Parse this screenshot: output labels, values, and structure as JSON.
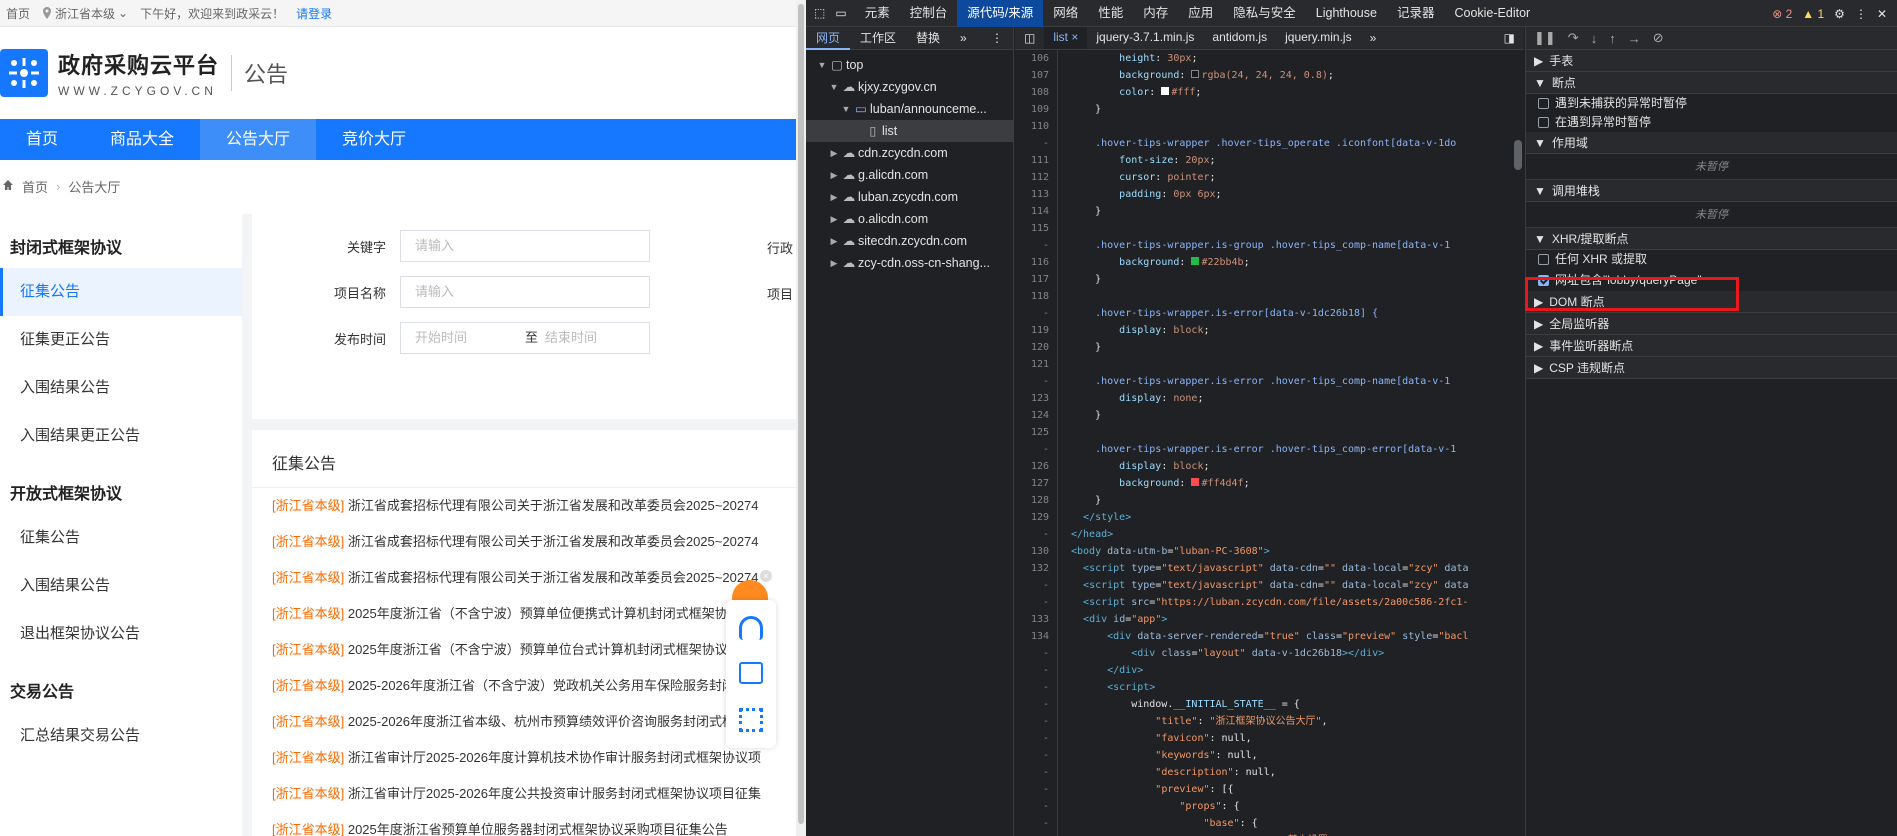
{
  "web": {
    "topbar": {
      "home": "首页",
      "location": "浙江省本级",
      "greeting": "下午好，欢迎来到政采云！",
      "login": "请登录"
    },
    "brand": {
      "name": "政府采购云平台",
      "url": "WWW.ZCYGOV.CN",
      "sub": "公告"
    },
    "nav": [
      "首页",
      "商品大全",
      "公告大厅",
      "竞价大厅"
    ],
    "breadcrumb": [
      "首页",
      "公告大厅"
    ],
    "sidebar": {
      "groups": [
        {
          "title": "封闭式框架协议",
          "items": [
            "征集公告",
            "征集更正公告",
            "入围结果公告",
            "入围结果更正公告"
          ]
        },
        {
          "title": "开放式框架协议",
          "items": [
            "征集公告",
            "入围结果公告",
            "退出框架协议公告"
          ]
        },
        {
          "title": "交易公告",
          "items": [
            "汇总结果交易公告"
          ]
        }
      ]
    },
    "filter": {
      "keyword_label": "关键字",
      "keyword_placeholder": "请输入",
      "project_label": "项目名称",
      "project_placeholder": "请输入",
      "date_label": "发布时间",
      "date_start": "开始时间",
      "date_sep": "至",
      "date_end": "结束时间",
      "right1": "行政",
      "right2": "项目"
    },
    "list": {
      "title": "征集公告",
      "items": [
        {
          "tag": "[浙江省本级]",
          "text": " 浙江省成套招标代理有限公司关于浙江省发展和改革委员会2025~20274"
        },
        {
          "tag": "[浙江省本级]",
          "text": " 浙江省成套招标代理有限公司关于浙江省发展和改革委员会2025~20274"
        },
        {
          "tag": "[浙江省本级]",
          "text": " 浙江省成套招标代理有限公司关于浙江省发展和改革委员会2025~20274"
        },
        {
          "tag": "[浙江省本级]",
          "text": " 2025年度浙江省（不含宁波）预算单位便携式计算机封闭式框架协议采"
        },
        {
          "tag": "[浙江省本级]",
          "text": " 2025年度浙江省（不含宁波）预算单位台式计算机封闭式框架协议采购"
        },
        {
          "tag": "[浙江省本级]",
          "text": " 2025-2026年度浙江省（不含宁波）党政机关公务用车保险服务封闭式框"
        },
        {
          "tag": "[浙江省本级]",
          "text": " 2025-2026年度浙江省本级、杭州市预算绩效评价咨询服务封闭式框架协"
        },
        {
          "tag": "[浙江省本级]",
          "text": " 浙江省审计厅2025-2026年度计算机技术协作审计服务封闭式框架协议项"
        },
        {
          "tag": "[浙江省本级]",
          "text": " 浙江省审计厅2025-2026年度公共投资审计服务封闭式框架协议项目征集"
        },
        {
          "tag": "[浙江省本级]",
          "text": " 2025年度浙江省预算单位服务器封闭式框架协议采购项目征集公告"
        }
      ]
    }
  },
  "devtools": {
    "tabs": [
      "元素",
      "控制台",
      "源代码/来源",
      "网络",
      "性能",
      "内存",
      "应用",
      "隐私与安全",
      "Lighthouse",
      "记录器",
      "Cookie-Editor"
    ],
    "selected_tab": "源代码/来源",
    "errors": "2",
    "warnings": "1",
    "nav_tabs": [
      "网页",
      "工作区",
      "替换"
    ],
    "tree": [
      {
        "label": "top",
        "depth": 0,
        "arrow": "▼",
        "icon": "frame"
      },
      {
        "label": "kjxy.zcygov.cn",
        "depth": 1,
        "arrow": "▼",
        "icon": "cloud"
      },
      {
        "label": "luban/announceme...",
        "depth": 2,
        "arrow": "▼",
        "icon": "folder"
      },
      {
        "label": "list",
        "depth": 3,
        "arrow": "",
        "icon": "file"
      },
      {
        "label": "cdn.zcycdn.com",
        "depth": 1,
        "arrow": "▶",
        "icon": "cloud"
      },
      {
        "label": "g.alicdn.com",
        "depth": 1,
        "arrow": "▶",
        "icon": "cloud"
      },
      {
        "label": "luban.zcycdn.com",
        "depth": 1,
        "arrow": "▶",
        "icon": "cloud"
      },
      {
        "label": "o.alicdn.com",
        "depth": 1,
        "arrow": "▶",
        "icon": "cloud"
      },
      {
        "label": "sitecdn.zcycdn.com",
        "depth": 1,
        "arrow": "▶",
        "icon": "cloud"
      },
      {
        "label": "zcy-cdn.oss-cn-shang...",
        "depth": 1,
        "arrow": "▶",
        "icon": "cloud"
      }
    ],
    "editor_tabs": [
      "list",
      "jquery-3.7.1.min.js",
      "antidom.js",
      "jquery.min.js"
    ],
    "code": [
      {
        "n": "106",
        "h": "        <span class=c-prop>height</span>: <span class=c-val>30px</span>;"
      },
      {
        "n": "107",
        "h": "        <span class=c-prop>background</span>: <span class=c-val>▪rgba(24, 24, 24, 0.8)</span>;"
      },
      {
        "n": "108",
        "h": "        <span class=c-prop>color</span>: <span class=c-val>▪#fff</span>;"
      },
      {
        "n": "109",
        "h": "    }"
      },
      {
        "n": "110",
        "h": ""
      },
      {
        "n": "-",
        "h": "    <span class=c-sel>.hover-tips-wrapper .hover-tips_operate .iconfont[data-v-1do</span>"
      },
      {
        "n": "111",
        "h": "        <span class=c-prop>font-size</span>: <span class=c-val>20px</span>;"
      },
      {
        "n": "112",
        "h": "        <span class=c-prop>cursor</span>: <span class=c-val>pointer</span>;"
      },
      {
        "n": "113",
        "h": "        <span class=c-prop>padding</span>: <span class=c-val>0px 6px</span>;"
      },
      {
        "n": "114",
        "h": "    }"
      },
      {
        "n": "115",
        "h": ""
      },
      {
        "n": "-",
        "h": "    <span class=c-sel>.hover-tips-wrapper.is-group .hover-tips_comp-name[data-v-1</span>"
      },
      {
        "n": "116",
        "h": "        <span class=c-prop>background</span>: <span class=c-val>▪#22bb4b</span>;"
      },
      {
        "n": "117",
        "h": "    }"
      },
      {
        "n": "118",
        "h": ""
      },
      {
        "n": "-",
        "h": "    <span class=c-sel>.hover-tips-wrapper.is-error[data-v-1dc26b18] {</span>"
      },
      {
        "n": "119",
        "h": "        <span class=c-prop>display</span>: <span class=c-val>block</span>;"
      },
      {
        "n": "120",
        "h": "    }"
      },
      {
        "n": "121",
        "h": ""
      },
      {
        "n": "-",
        "h": "    <span class=c-sel>.hover-tips-wrapper.is-error .hover-tips_comp-name[data-v-1</span>"
      },
      {
        "n": "123",
        "h": "        <span class=c-prop>display</span>: <span class=c-val>none</span>;"
      },
      {
        "n": "124",
        "h": "    }"
      },
      {
        "n": "125",
        "h": ""
      },
      {
        "n": "-",
        "h": "    <span class=c-sel>.hover-tips-wrapper.is-error .hover-tips_comp-error[data-v-1</span>"
      },
      {
        "n": "126",
        "h": "        <span class=c-prop>display</span>: <span class=c-val>block</span>;"
      },
      {
        "n": "127",
        "h": "        <span class=c-prop>background</span>: <span class=c-val>▪#ff4d4f</span>;"
      },
      {
        "n": "128",
        "h": "    }"
      },
      {
        "n": "129",
        "h": "  <span class=c-tag>&lt;/style&gt;</span>"
      },
      {
        "n": "-",
        "h": "<span class=c-tag>&lt;/head&gt;</span>"
      },
      {
        "n": "130",
        "h": "<span class=c-tag>&lt;body</span> <span class=c-attr>data-utm-b</span>=<span class=c-str>\"luban-PC-3608\"</span><span class=c-tag>&gt;</span>"
      },
      {
        "n": "132",
        "h": "  <span class=c-tag>&lt;script</span> <span class=c-attr>type</span>=<span class=c-str>\"text/javascript\"</span> <span class=c-attr>data-cdn</span>=<span class=c-str>\"\"</span> <span class=c-attr>data-local</span>=<span class=c-str>\"zcy\"</span> <span class=c-attr>data</span>"
      },
      {
        "n": "-",
        "h": "  <span class=c-tag>&lt;script</span> <span class=c-attr>type</span>=<span class=c-str>\"text/javascript\"</span> <span class=c-attr>data-cdn</span>=<span class=c-str>\"\"</span> <span class=c-attr>data-local</span>=<span class=c-str>\"zcy\"</span> <span class=c-attr>data</span>"
      },
      {
        "n": "-",
        "h": "  <span class=c-tag>&lt;script</span> <span class=c-attr>src</span>=<span class=c-str>\"https://luban.zcycdn.com/file/assets/2a00c586-2fc1-</span>"
      },
      {
        "n": "133",
        "h": "  <span class=c-tag>&lt;div</span> <span class=c-attr>id</span>=<span class=c-str>\"app\"</span><span class=c-tag>&gt;</span>"
      },
      {
        "n": "134",
        "h": "      <span class=c-tag>&lt;div</span> <span class=c-attr>data-server-rendered</span>=<span class=c-str>\"true\"</span> <span class=c-attr>class</span>=<span class=c-str>\"preview\"</span> <span class=c-attr>style</span>=<span class=c-str>\"bacl</span>"
      },
      {
        "n": "-",
        "h": "          <span class=c-tag>&lt;div</span> <span class=c-attr>class</span>=<span class=c-str>\"layout\"</span> <span class=c-attr>data-v-1dc26b18</span><span class=c-tag>&gt;&lt;/div&gt;</span>"
      },
      {
        "n": "-",
        "h": "      <span class=c-tag>&lt;/div&gt;</span>"
      },
      {
        "n": "-",
        "h": "      <span class=c-tag>&lt;script&gt;</span>"
      },
      {
        "n": "-",
        "h": "          window.<span class=c-prop>__INITIAL_STATE__</span> = {"
      },
      {
        "n": "-",
        "h": "              <span class=c-str>\"title\"</span>: <span class=c-str>\"浙江框架协议公告大厅\"</span>,"
      },
      {
        "n": "-",
        "h": "              <span class=c-str>\"favicon\"</span>: null,"
      },
      {
        "n": "-",
        "h": "              <span class=c-str>\"keywords\"</span>: null,"
      },
      {
        "n": "-",
        "h": "              <span class=c-str>\"description\"</span>: null,"
      },
      {
        "n": "-",
        "h": "              <span class=c-str>\"preview\"</span>: [{"
      },
      {
        "n": "-",
        "h": "                  <span class=c-str>\"props\"</span>: {"
      },
      {
        "n": "-",
        "h": "                      <span class=c-str>\"base\"</span>: {"
      },
      {
        "n": "-",
        "h": "                          <span class=c-str>\"group\"</span>: <span class=c-str>\"基本设置\"</span>,"
      }
    ],
    "debugger": {
      "sections": [
        {
          "label": "手表",
          "open": false
        },
        {
          "label": "断点",
          "open": true
        },
        {
          "label": "作用域",
          "open": true
        },
        {
          "label": "调用堆栈",
          "open": true
        },
        {
          "label": "XHR/提取断点",
          "open": true
        },
        {
          "label": "DOM 断点",
          "open": false
        },
        {
          "label": "全局监听器",
          "open": false
        },
        {
          "label": "事件监听器断点",
          "open": false
        },
        {
          "label": "CSP 违规断点",
          "open": false
        }
      ],
      "pause_uncaught": "遇到未捕获的异常时暂停",
      "pause_caught": "在遇到异常时暂停",
      "not_paused": "未暂停",
      "any_xhr": "任何 XHR 或提取",
      "url_contains": "网址包含\"lobby/queryPage\""
    }
  }
}
